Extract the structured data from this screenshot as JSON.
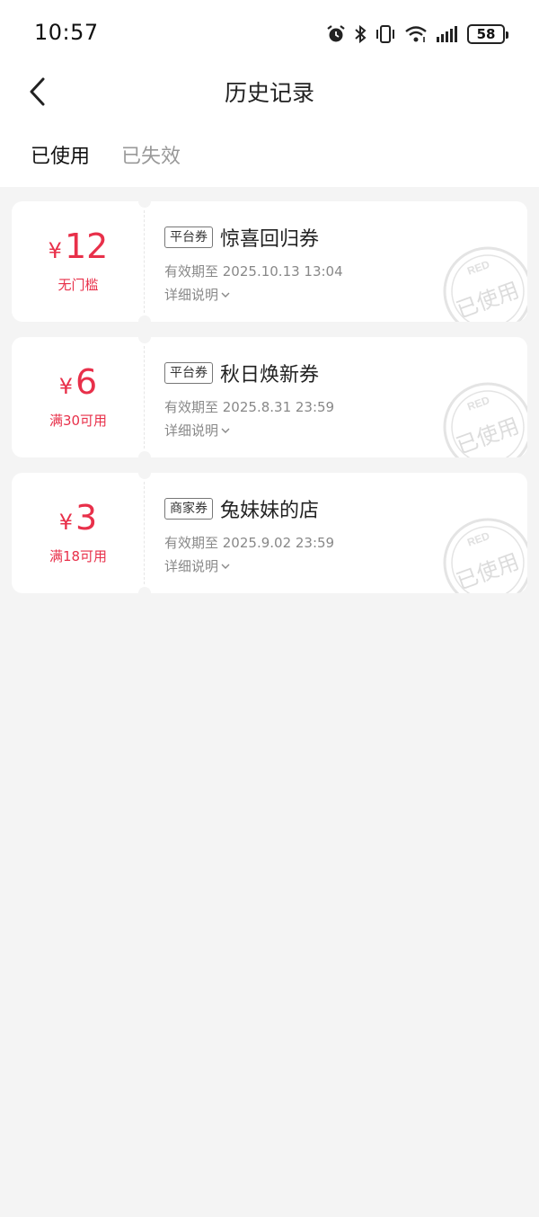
{
  "status_bar": {
    "time": "10:57",
    "battery": "58",
    "icons": [
      "alarm-icon",
      "bluetooth-icon",
      "vibrate-icon",
      "wifi-icon",
      "signal-icon",
      "battery-icon"
    ]
  },
  "header": {
    "title": "历史记录",
    "back_icon": "chevron-left-icon"
  },
  "tabs": [
    {
      "label": "已使用",
      "active": true
    },
    {
      "label": "已失效",
      "active": false
    }
  ],
  "coupons": [
    {
      "currency": "¥",
      "value": "12",
      "condition": "无门槛",
      "tag": "平台券",
      "name": "惊喜回归券",
      "validity": "有效期至 2025.10.13 13:04",
      "detail": "详细说明",
      "stamp_top": "RED",
      "stamp_text": "已使用"
    },
    {
      "currency": "¥",
      "value": "6",
      "condition": "满30可用",
      "tag": "平台券",
      "name": "秋日焕新券",
      "validity": "有效期至 2025.8.31 23:59",
      "detail": "详细说明",
      "stamp_top": "RED",
      "stamp_text": "已使用"
    },
    {
      "currency": "¥",
      "value": "3",
      "condition": "满18可用",
      "tag": "商家券",
      "name": "兔妹妹的店",
      "validity": "有效期至 2025.9.02 23:59",
      "detail": "详细说明",
      "stamp_top": "RED",
      "stamp_text": "已使用"
    }
  ],
  "colors": {
    "accent": "#e8304a",
    "background": "#f4f4f4",
    "card": "#ffffff",
    "muted": "#888888"
  }
}
